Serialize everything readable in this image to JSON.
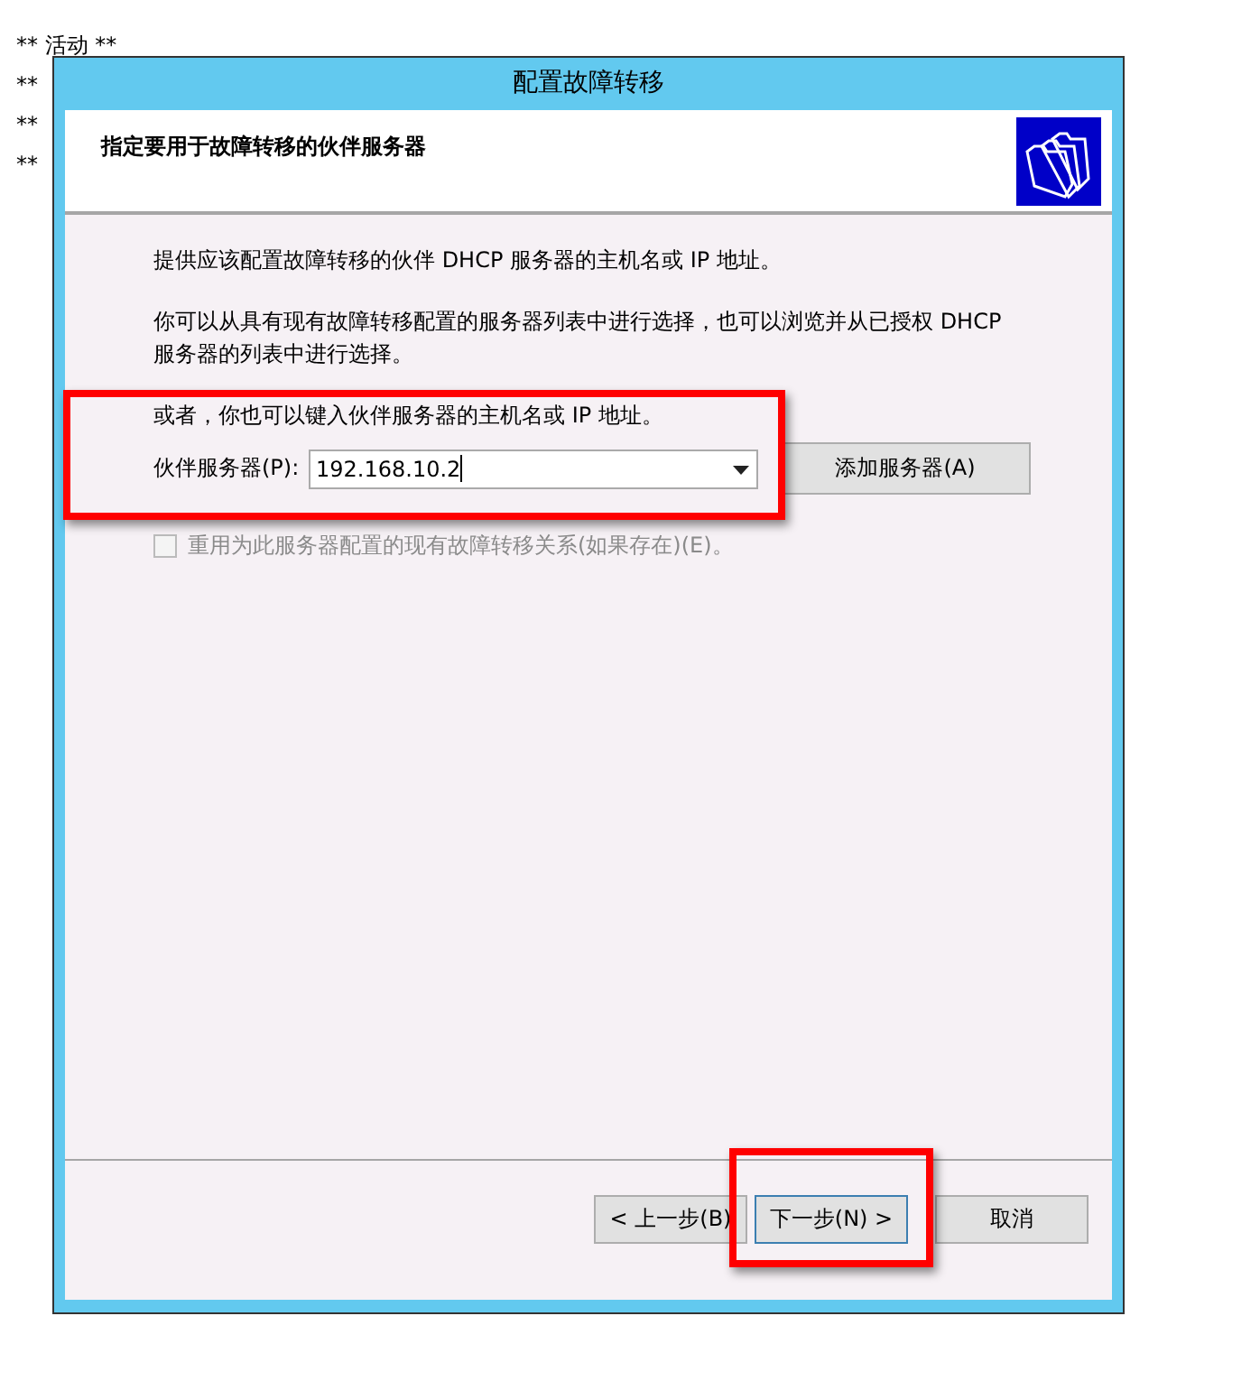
{
  "background_lines": [
    "** 活动 **",
    "**",
    "**",
    "**"
  ],
  "dialog": {
    "title": "配置故障转移",
    "header": "指定要用于故障转移的伙伴服务器",
    "paragraphs": [
      "提供应该配置故障转移的伙伴 DHCP 服务器的主机名或 IP 地址。",
      "你可以从具有现有故障转移配置的服务器列表中进行选择，也可以浏览并从已授权 DHCP 服务器的列表中进行选择。"
    ],
    "partner": {
      "hint": "或者，你也可以键入伙伴服务器的主机名或 IP 地址。",
      "label": "伙伴服务器(P):",
      "value": "192.168.10.2",
      "highlighted": true
    },
    "add_button": "添加服务器(A)",
    "checkbox": {
      "label": "重用为此服务器配置的现有故障转移关系(如果存在)(E)。",
      "checked": false,
      "disabled": true
    },
    "buttons": [
      {
        "label": "< 上一步(B)",
        "focused": false,
        "highlighted": false
      },
      {
        "label": "下一步(N) >",
        "focused": true,
        "highlighted": true
      },
      {
        "label": "取消",
        "focused": false,
        "highlighted": false
      }
    ]
  }
}
